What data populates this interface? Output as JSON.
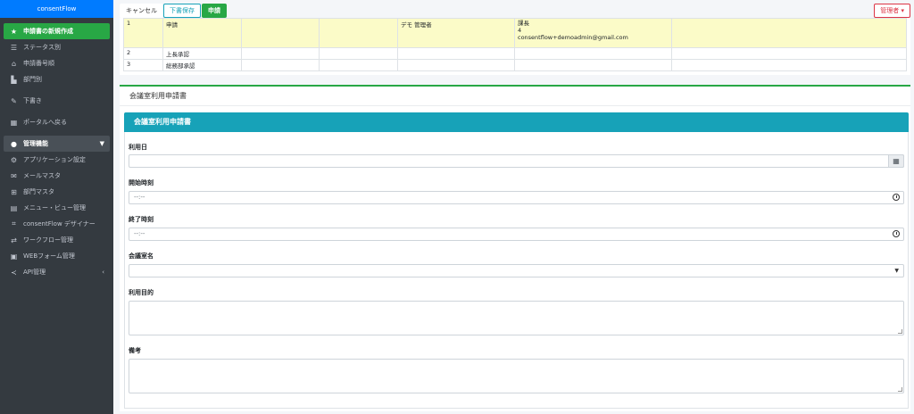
{
  "brand": "consentFlow",
  "sidebar": {
    "items": [
      {
        "label": "申請書の新規作成",
        "icon": "star-icon"
      },
      {
        "label": "ステータス別",
        "icon": "list-icon"
      },
      {
        "label": "申請番号順",
        "icon": "inbox-icon"
      },
      {
        "label": "部門別",
        "icon": "bar-chart-icon"
      },
      {
        "label": "下書き",
        "icon": "edit-icon"
      },
      {
        "label": "ポータルへ戻る",
        "icon": "building-icon"
      }
    ],
    "admin_header": "管理機能",
    "admin_items": [
      {
        "label": "アプリケーション設定",
        "icon": "gear-icon"
      },
      {
        "label": "メールマスタ",
        "icon": "mail-icon"
      },
      {
        "label": "部門マスタ",
        "icon": "sitemap-icon"
      },
      {
        "label": "メニュー・ビュー管理",
        "icon": "table-icon"
      },
      {
        "label": "consentFlow デザイナー",
        "icon": "designer-icon"
      },
      {
        "label": "ワークフロー管理",
        "icon": "workflow-icon"
      },
      {
        "label": "WEBフォーム管理",
        "icon": "form-icon"
      },
      {
        "label": "API管理",
        "icon": "share-icon"
      }
    ]
  },
  "toolbar": {
    "cancel": "キャンセル",
    "draft": "下書保存",
    "apply": "申請",
    "admin": "管理者 ▾"
  },
  "approval": {
    "rows": [
      {
        "no": "1",
        "step": "申請",
        "c3": "",
        "c4": "",
        "person": "デモ 管理者",
        "info": "課長\n4\nconsentflow+demoadmin@gmail.com"
      },
      {
        "no": "2",
        "step": "上長承認",
        "c3": "",
        "c4": "",
        "person": "",
        "info": ""
      },
      {
        "no": "3",
        "step": "総務部承認",
        "c3": "",
        "c4": "",
        "person": "",
        "info": ""
      }
    ]
  },
  "form": {
    "title": "会議室利用申請書",
    "section_title": "会議室利用申請書",
    "fields": {
      "date_label": "利用日",
      "start_label": "開始時刻",
      "start_value": "--:--",
      "end_label": "終了時刻",
      "end_value": "--:--",
      "room_label": "会議室名",
      "purpose_label": "利用目的",
      "notes_label": "備考"
    }
  },
  "colors": {
    "sidebar": "#343a40",
    "brand": "#007bff",
    "active": "#28a745",
    "section": "#17a2b8",
    "admin": "#dc3545"
  }
}
